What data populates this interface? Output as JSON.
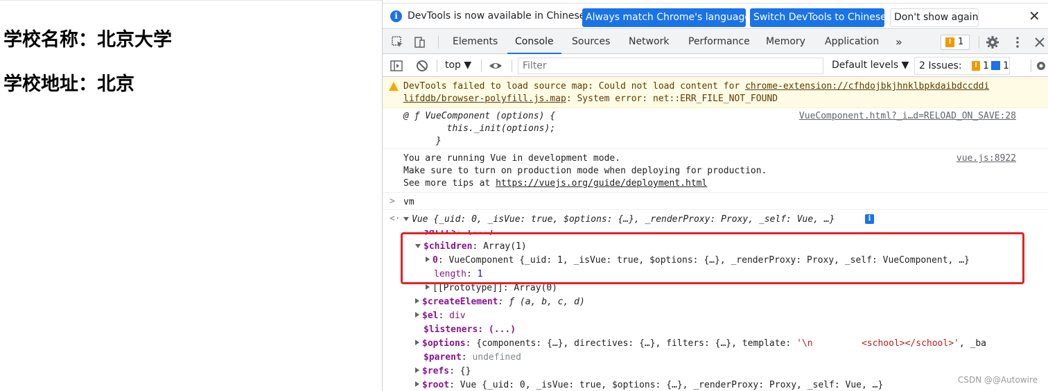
{
  "page": {
    "school_name": "学校名称：北京大学",
    "school_address": "学校地址：北京"
  },
  "infobar": {
    "message": "DevTools is now available in Chinese!",
    "btn_match": "Always match Chrome's language",
    "btn_switch": "Switch DevTools to Chinese",
    "btn_dont_show": "Don't show again",
    "close": "✕"
  },
  "tabs": {
    "elements": "Elements",
    "console": "Console",
    "sources": "Sources",
    "network": "Network",
    "performance": "Performance",
    "memory": "Memory",
    "application": "Application",
    "more": "»",
    "issue_count": "1"
  },
  "filterbar": {
    "context": "top ▼",
    "filter_placeholder": "Filter",
    "levels": "Default levels ▼",
    "issues_label": "2 Issues:",
    "issues_warn": "1",
    "issues_info": "1"
  },
  "console": {
    "warn_line1": "DevTools failed to load source map: Could not load content for ",
    "warn_link1": "chrome-extension://cfhdojbkjhnklbpkdaibdccddi",
    "warn_link2": "lifddb/browser-polyfill.js.map",
    "warn_line2_rest": ": System error: net::ERR_FILE_NOT_FOUND",
    "fn_line1": "@ ƒ VueComponent (options) {",
    "fn_line2": "        this._init(options);",
    "fn_line3": "      }",
    "fn_src": "VueComponent.html?_i…d=RELOAD_ON_SAVE:28",
    "vue_line1": "You are running Vue in development mode.",
    "vue_line2": "Make sure to turn on production mode when deploying for production.",
    "vue_line3_prefix": "See more tips at ",
    "vue_line3_link": "https://vuejs.org/guide/deployment.html",
    "vue_src": "vue.js:8922",
    "input_cmd": "vm",
    "vm_summary": "Vue {_uid: 0, _isVue: true, $options: {…}, _renderProxy: Proxy, _self: Vue, …}",
    "attrs": "$attrs: (...)",
    "children_key": "$children",
    "children_val": ": Array(1)",
    "child0_key": "0",
    "child0_val": ": VueComponent {_uid: 1, _isVue: true, $options: {…}, _renderProxy: Proxy, _self: VueComponent, …}",
    "length_key": "length",
    "length_val": "1",
    "proto": "[[Prototype]]: Array(0)",
    "create_key": "$createElement",
    "create_val": ": ƒ (a, b, c, d)",
    "el_key": "$el",
    "el_val": "div",
    "listeners": "$listeners: (...)",
    "options_key": "$options",
    "options_val": ": {components: {…}, directives: {…}, filters: {…}, template: ",
    "options_str": "'\\n         <school></school>'",
    "options_tail": ", _ba",
    "parent_key": "$parent",
    "parent_val": "undefined",
    "refs_key": "$refs",
    "refs_val": ": {}",
    "root_key": "$root",
    "root_val": ": Vue {_uid: 0, _isVue: true, $options: {…}, _renderProxy: Proxy, _self: Vue, …}"
  },
  "watermark": "CSDN @@Autowire"
}
